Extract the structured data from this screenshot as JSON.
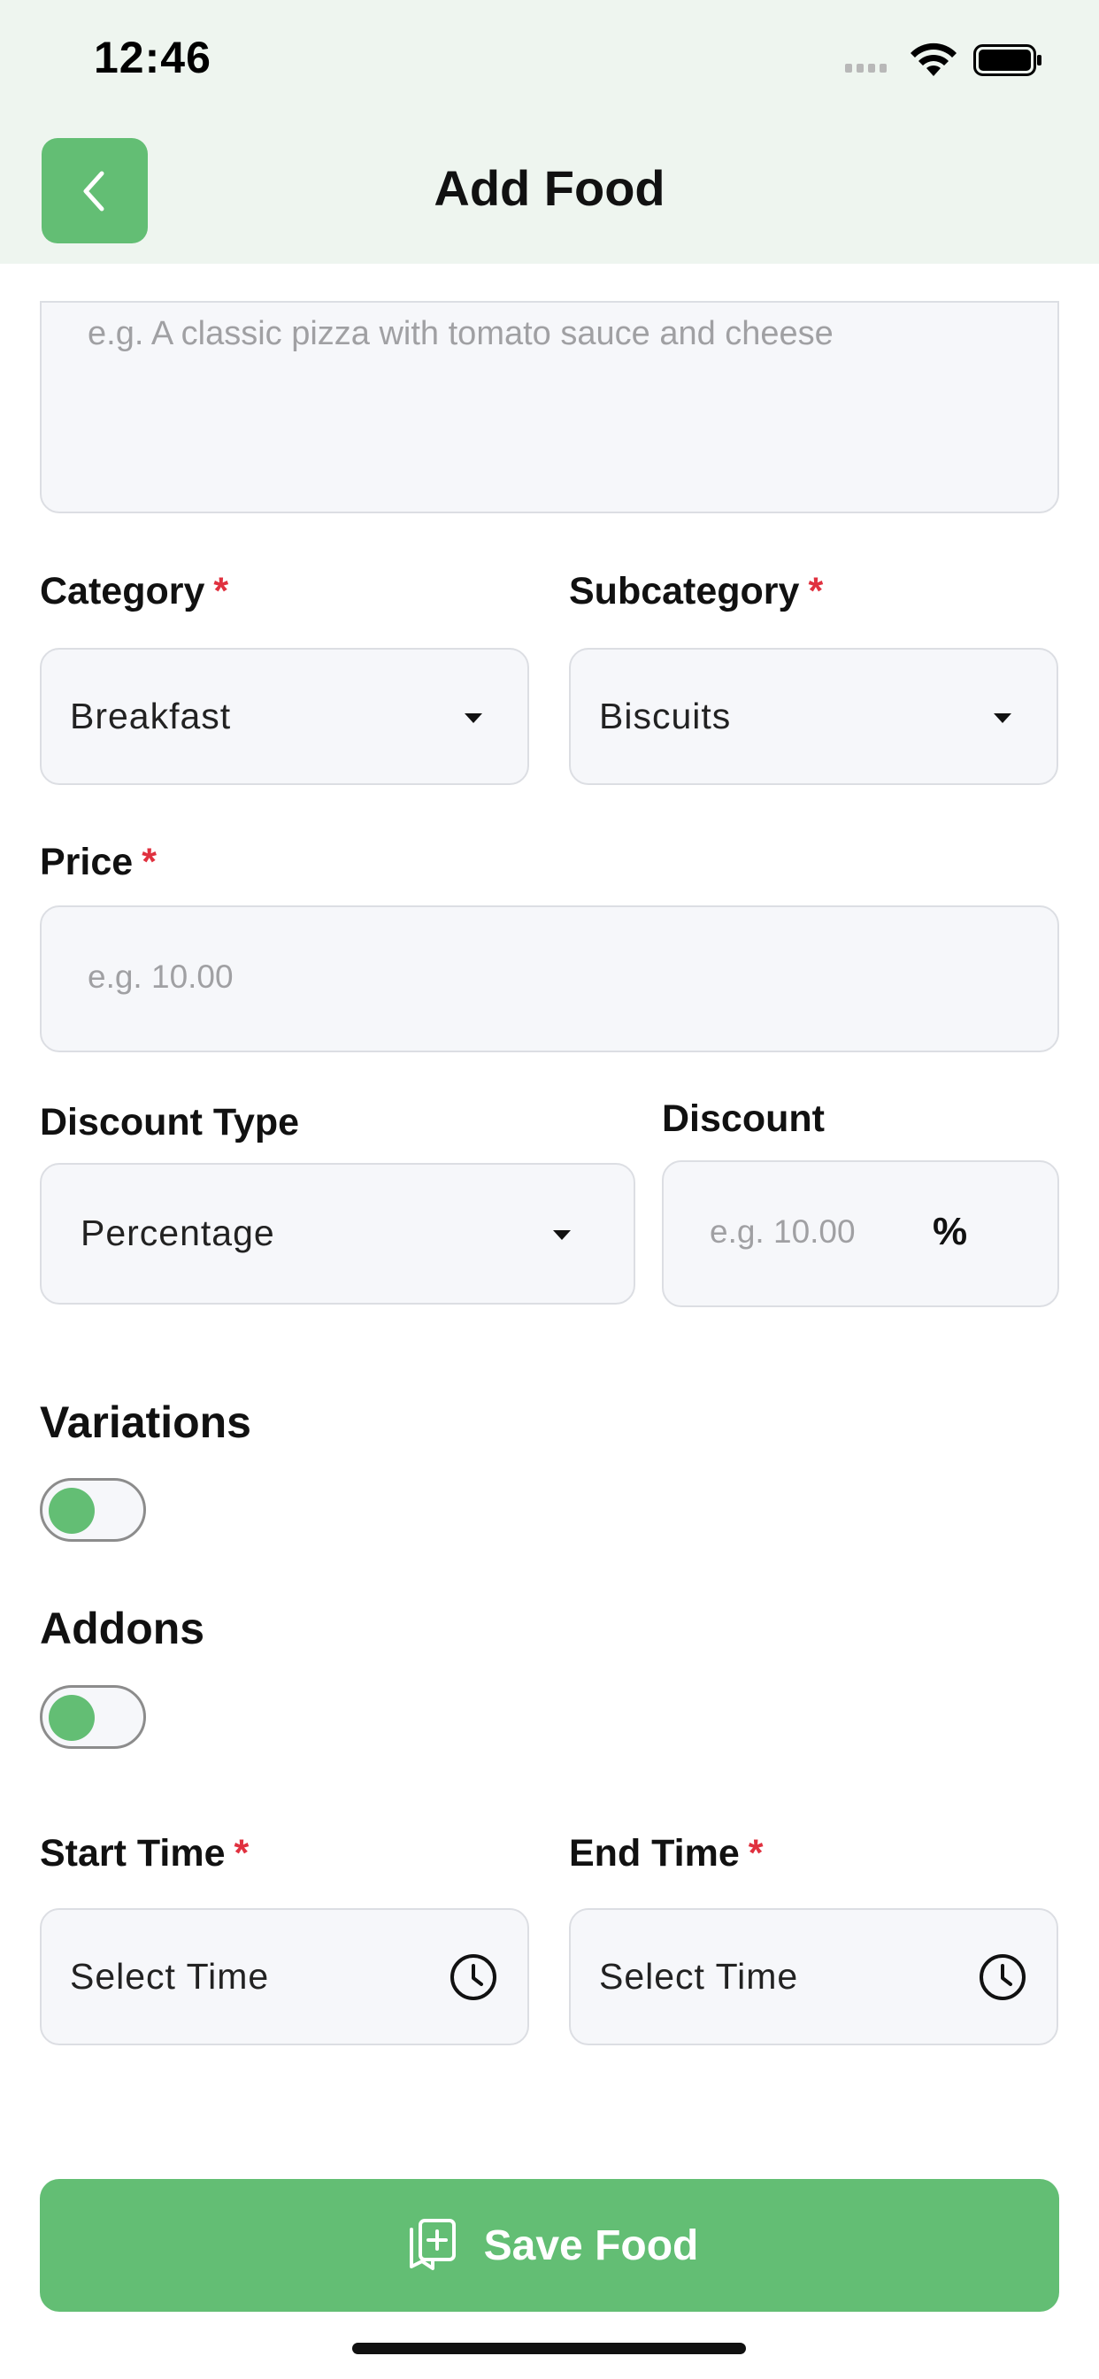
{
  "status_bar": {
    "time": "12:46"
  },
  "header": {
    "title": "Add Food",
    "back_icon": "chevron-left-icon"
  },
  "description": {
    "placeholder": "e.g. A classic pizza with tomato sauce and cheese"
  },
  "category": {
    "label": "Category",
    "required": "*",
    "value": "Breakfast"
  },
  "subcategory": {
    "label": "Subcategory",
    "required": "*",
    "value": "Biscuits"
  },
  "price": {
    "label": "Price",
    "required": "*",
    "placeholder": "e.g. 10.00"
  },
  "discount_type": {
    "label": "Discount Type",
    "value": "Percentage"
  },
  "discount": {
    "label": "Discount",
    "placeholder": "e.g. 10.00",
    "unit": "%"
  },
  "variations": {
    "label": "Variations",
    "enabled": false
  },
  "addons": {
    "label": "Addons",
    "enabled": false
  },
  "start_time": {
    "label": "Start Time",
    "required": "*",
    "value": "Select Time",
    "icon": "clock-icon"
  },
  "end_time": {
    "label": "End Time",
    "required": "*",
    "value": "Select Time",
    "icon": "clock-icon"
  },
  "save_button": {
    "label": "Save Food",
    "icon": "add-document-icon"
  },
  "colors": {
    "accent": "#63be74",
    "header_bg": "#eef5ef",
    "required": "#e0313f",
    "field_bg": "#f6f7fa",
    "field_border": "#dcdee3"
  }
}
